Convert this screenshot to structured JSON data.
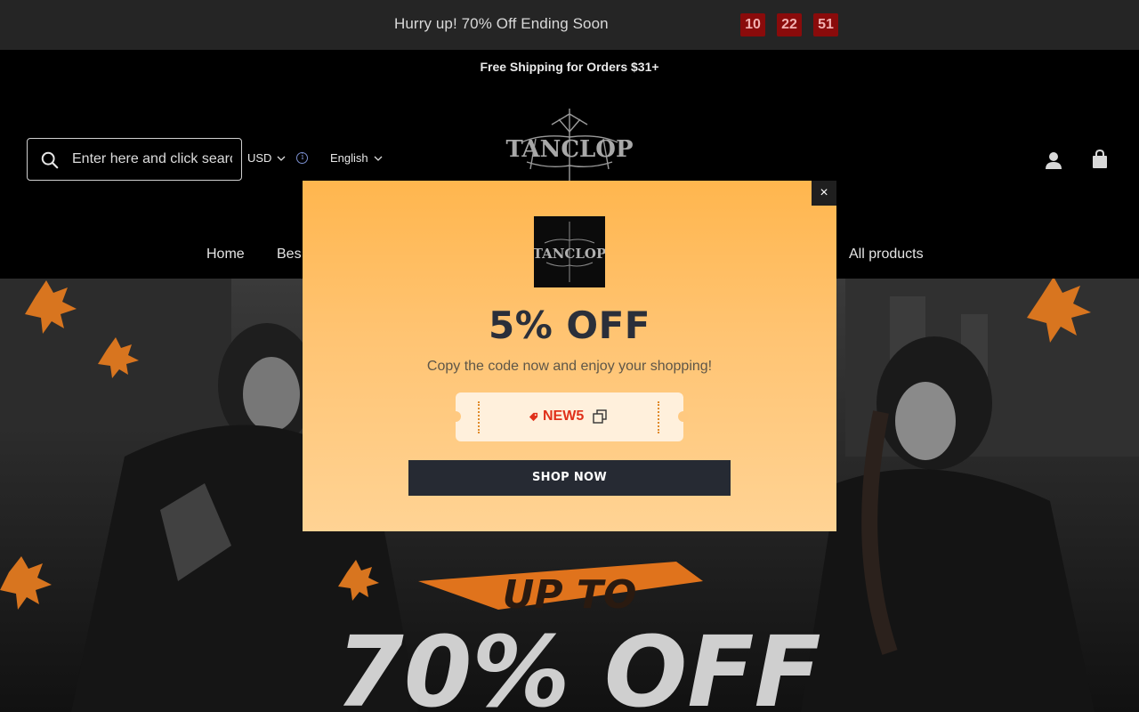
{
  "announcement": {
    "message": "Hurry up! 70% Off Ending Soon",
    "timer": [
      "10",
      "22",
      "51"
    ]
  },
  "shipping_bar": {
    "text": "Free Shipping for Orders $31+"
  },
  "header": {
    "search_placeholder": "Enter here and click search",
    "currency": "USD",
    "language": "English",
    "brand": "TANCLOP"
  },
  "nav": {
    "items": [
      "Home",
      "Bes",
      "All products"
    ]
  },
  "popup": {
    "brand": "TANCLOP",
    "title": "5% OFF",
    "subtitle": "Copy the code now and enjoy your shopping!",
    "coupon_code": "NEW5",
    "cta": "SHOP NOW",
    "close": "×"
  },
  "hero": {
    "line1": "UP TO",
    "line2": "70% OFF"
  },
  "colors": {
    "accent_orange": "#ffb64e",
    "timer_red": "#8a0b0b",
    "code_red": "#e0301a",
    "button_dark": "#262a33"
  },
  "icons": [
    "search-icon",
    "chevron-down-icon",
    "info-icon",
    "account-icon",
    "cart-icon",
    "close-icon",
    "tag-icon",
    "copy-icon"
  ]
}
